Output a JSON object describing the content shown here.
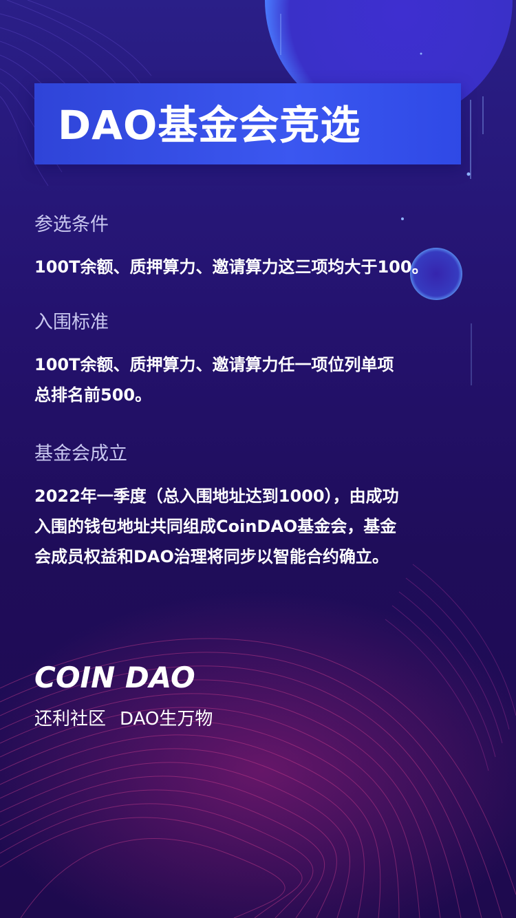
{
  "header": {
    "title": "DAO基金会竞选"
  },
  "sections": [
    {
      "label": "参选条件",
      "lines": [
        "100T余额、质押算力、邀请算力这三项均大于100。"
      ]
    },
    {
      "label": "入围标准",
      "lines": [
        "100T余额、质押算力、邀请算力任一项位列单项",
        "总排名前500。"
      ]
    },
    {
      "label": "基金会成立",
      "lines": [
        "2022年一季度（总入围地址达到1000），由成功",
        "入围的钱包地址共同组成CoinDAO基金会，基金",
        "会成员权益和DAO治理将同步以智能合约确立。"
      ]
    }
  ],
  "footer": {
    "logo": "COIN DAO",
    "tagline_part1": "还利社区",
    "tagline_part2": "DAO生万物"
  },
  "colors": {
    "background_top": "#2a1f88",
    "background_bottom": "#1e0a4e",
    "title_box": "#3b57f0",
    "label_text": "#c9c8f0",
    "accent_pink": "#c0338f",
    "accent_blue": "#3f7dff"
  }
}
